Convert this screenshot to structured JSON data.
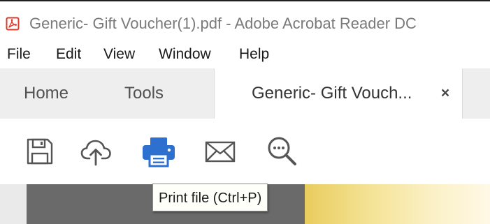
{
  "window": {
    "title": "Generic- Gift Voucher(1).pdf - Adobe Acrobat Reader DC",
    "app_icon": "acrobat-pdf-icon"
  },
  "menu": {
    "items": [
      "File",
      "Edit",
      "View",
      "Window",
      "Help"
    ]
  },
  "tabs": {
    "home_label": "Home",
    "tools_label": "Tools",
    "document_label": "Generic- Gift Vouch...",
    "close_glyph": "×"
  },
  "toolbar": {
    "icons": [
      "save-icon",
      "cloud-upload-icon",
      "print-icon",
      "email-icon",
      "zoom-search-icon"
    ],
    "active": "print-icon"
  },
  "tooltip": {
    "text": "Print file (Ctrl+P)"
  },
  "colors": {
    "accent_blue": "#2d70d0",
    "icon_gray": "#555555",
    "brand_red": "#dd3b2e"
  }
}
